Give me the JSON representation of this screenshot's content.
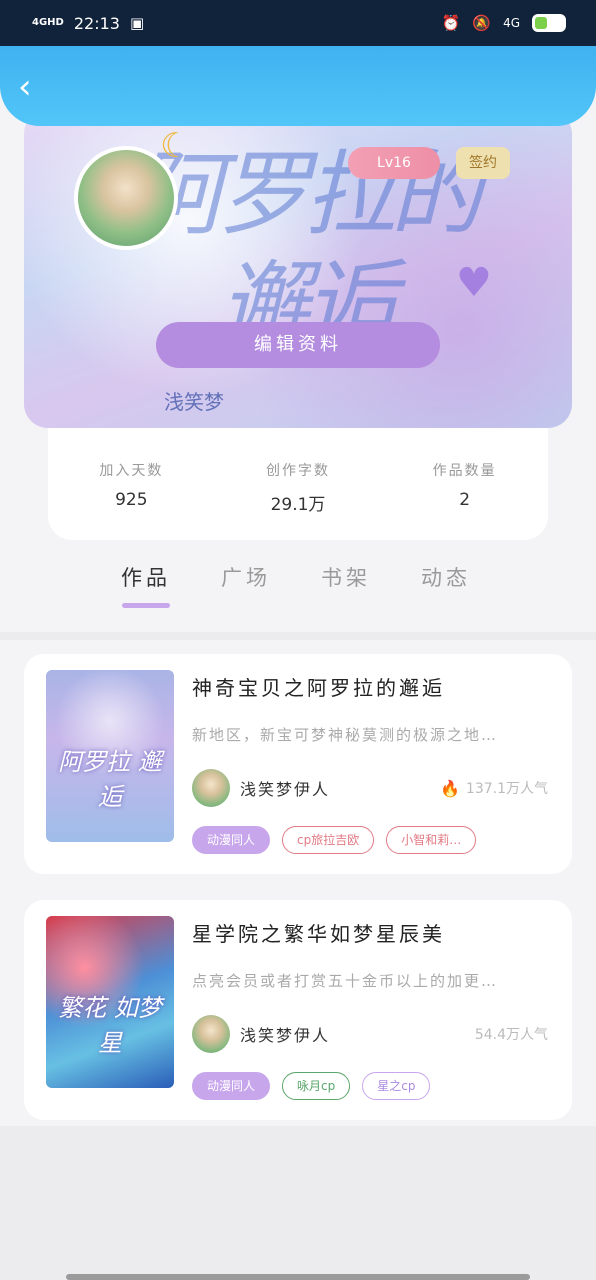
{
  "status_bar": {
    "network": "4GHD",
    "time": "22:13",
    "cellular": "4G"
  },
  "header": {
    "back_icon": "chevron-left-icon"
  },
  "profile": {
    "banner_title": "阿罗拉的邂逅",
    "banner_author": "浅笑梦",
    "level": "Lv16",
    "sign_badge": "签约",
    "edit_button": "编辑资料",
    "stats": [
      {
        "label": "加入天数",
        "value": "925"
      },
      {
        "label": "创作字数",
        "value": "29.1万"
      },
      {
        "label": "作品数量",
        "value": "2"
      }
    ]
  },
  "tabs": [
    {
      "label": "作品",
      "active": true
    },
    {
      "label": "广场",
      "active": false
    },
    {
      "label": "书架",
      "active": false
    },
    {
      "label": "动态",
      "active": false
    }
  ],
  "works": [
    {
      "title": "神奇宝贝之阿罗拉的邂逅",
      "cover_text": "阿罗拉 邂逅",
      "description": "新地区，新宝可梦神秘莫测的极源之地…",
      "author": "浅笑梦伊人",
      "popularity": "137.1万人气",
      "tags": [
        "动漫同人",
        "cp旅拉吉欧",
        "小智和莉…"
      ]
    },
    {
      "title": "星学院之繁华如梦星辰美",
      "cover_text": "繁花 如梦星",
      "description": "点亮会员或者打赏五十金币以上的加更…",
      "author": "浅笑梦伊人",
      "popularity": "54.4万人气",
      "tags": [
        "动漫同人",
        "咏月cp",
        "星之cp"
      ]
    }
  ],
  "colors": {
    "header_blue": "#3fb2f0",
    "accent_purple": "#c8a6ec",
    "level_pink": "#f29fb4"
  }
}
